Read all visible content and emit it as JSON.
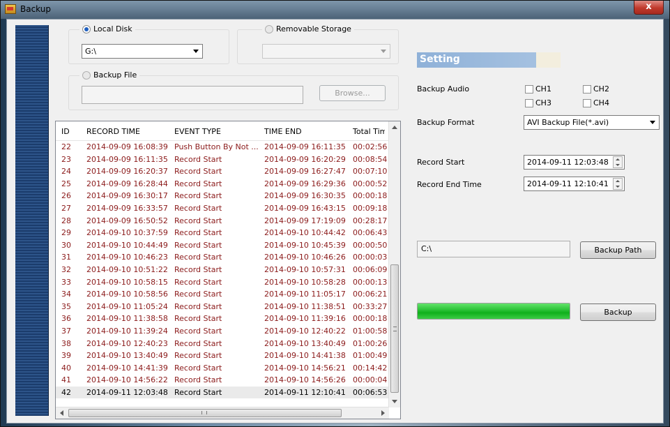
{
  "window": {
    "title": "Backup",
    "close_label": "x"
  },
  "source": {
    "local_disk_label": "Local Disk",
    "local_disk_value": "G:\\",
    "removable_label": "Removable Storage",
    "removable_value": "",
    "backup_file_label": "Backup File",
    "backup_file_path": "",
    "browse_label": "Browse..."
  },
  "table": {
    "columns": [
      "ID",
      "RECORD TIME",
      "EVENT TYPE",
      "TIME END",
      "Total Times"
    ],
    "rows": [
      [
        "22",
        "2014-09-09 16:08:39",
        "Push Button By Not ...",
        "2014-09-09 16:11:35",
        "00:02:56"
      ],
      [
        "23",
        "2014-09-09 16:11:35",
        "Record Start",
        "2014-09-09 16:20:29",
        "00:08:54"
      ],
      [
        "24",
        "2014-09-09 16:20:37",
        "Record Start",
        "2014-09-09 16:27:47",
        "00:07:10"
      ],
      [
        "25",
        "2014-09-09 16:28:44",
        "Record Start",
        "2014-09-09 16:29:36",
        "00:00:52"
      ],
      [
        "26",
        "2014-09-09 16:30:17",
        "Record Start",
        "2014-09-09 16:30:35",
        "00:00:18"
      ],
      [
        "27",
        "2014-09-09 16:33:57",
        "Record Start",
        "2014-09-09 16:43:15",
        "00:09:18"
      ],
      [
        "28",
        "2014-09-09 16:50:52",
        "Record Start",
        "2014-09-09 17:19:09",
        "00:28:17"
      ],
      [
        "29",
        "2014-09-10 10:37:59",
        "Record Start",
        "2014-09-10 10:44:42",
        "00:06:43"
      ],
      [
        "30",
        "2014-09-10 10:44:49",
        "Record Start",
        "2014-09-10 10:45:39",
        "00:00:50"
      ],
      [
        "31",
        "2014-09-10 10:46:23",
        "Record Start",
        "2014-09-10 10:46:26",
        "00:00:03"
      ],
      [
        "32",
        "2014-09-10 10:51:22",
        "Record Start",
        "2014-09-10 10:57:31",
        "00:06:09"
      ],
      [
        "33",
        "2014-09-10 10:58:15",
        "Record Start",
        "2014-09-10 10:58:28",
        "00:00:13"
      ],
      [
        "34",
        "2014-09-10 10:58:56",
        "Record Start",
        "2014-09-10 11:05:17",
        "00:06:21"
      ],
      [
        "35",
        "2014-09-10 11:05:24",
        "Record Start",
        "2014-09-10 11:38:51",
        "00:33:27"
      ],
      [
        "36",
        "2014-09-10 11:38:58",
        "Record Start",
        "2014-09-10 11:39:16",
        "00:00:18"
      ],
      [
        "37",
        "2014-09-10 11:39:24",
        "Record Start",
        "2014-09-10 12:40:22",
        "01:00:58"
      ],
      [
        "38",
        "2014-09-10 12:40:23",
        "Record Start",
        "2014-09-10 13:40:49",
        "01:00:26"
      ],
      [
        "39",
        "2014-09-10 13:40:49",
        "Record Start",
        "2014-09-10 14:41:38",
        "01:00:49"
      ],
      [
        "40",
        "2014-09-10 14:41:39",
        "Record Start",
        "2014-09-10 14:56:21",
        "00:14:42"
      ],
      [
        "41",
        "2014-09-10 14:56:22",
        "Record Start",
        "2014-09-10 14:56:26",
        "00:00:04"
      ],
      [
        "42",
        "2014-09-11 12:03:48",
        "Record Start",
        "2014-09-11 12:10:41",
        "00:06:53"
      ]
    ],
    "selected_row_index": 20
  },
  "setting": {
    "title": "Setting",
    "backup_audio_label": "Backup Audio",
    "channels": [
      "CH1",
      "CH2",
      "CH3",
      "CH4"
    ],
    "backup_format_label": "Backup Format",
    "backup_format_value": "AVI Backup File(*.avi)",
    "record_start_label": "Record Start",
    "record_start_value": "2014-09-11 12:03:48",
    "record_end_label": "Record End Time",
    "record_end_value": "2014-09-11 12:10:41",
    "backup_path_value": "C:\\",
    "backup_path_button": "Backup Path",
    "progress_percent": 100,
    "backup_button": "Backup"
  },
  "colors": {
    "row_text": "#8b1a1a",
    "progress": "#10b01b",
    "banner": "#8fb1d8"
  }
}
